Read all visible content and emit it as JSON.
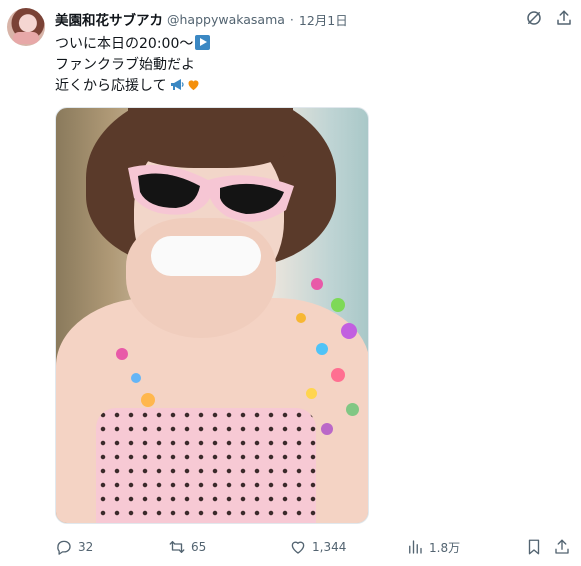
{
  "tweet": {
    "display_name": "美園和花サブアカ",
    "handle": "@happywakasama",
    "separator": "·",
    "timestamp": "12月1日",
    "text_lines": [
      "ついに本日の20:00〜",
      "ファンクラブ始動だよ",
      "近くから応援して"
    ],
    "emojis": [
      "play-button-emoji",
      "megaphone-emoji",
      "orange-heart-emoji"
    ]
  },
  "actions": {
    "reply_count": "32",
    "retweet_count": "65",
    "like_count": "1,344",
    "view_count": "1.8万"
  },
  "colors": {
    "secondary_text": "#536471",
    "primary_text": "#0f1419",
    "accent_play": "#3b88c3",
    "orange_heart": "#f4900c"
  }
}
